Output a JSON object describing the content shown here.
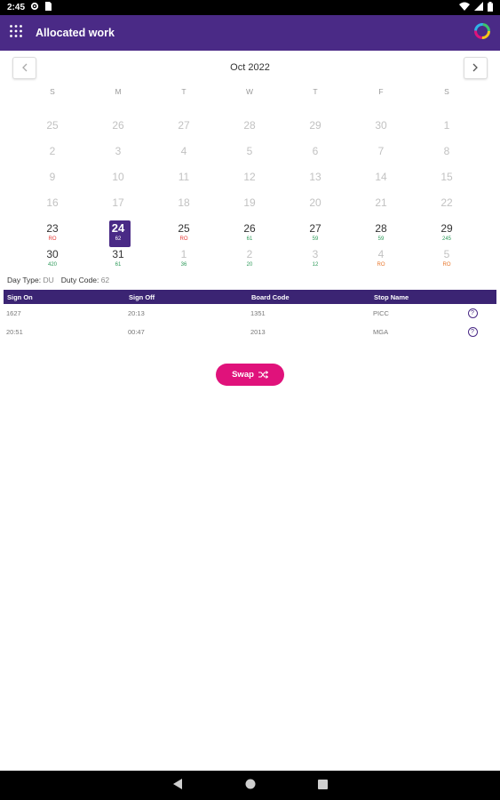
{
  "status_bar": {
    "time": "2:45"
  },
  "app_bar": {
    "title": "Allocated work"
  },
  "calendar": {
    "month_label": "Oct 2022",
    "weekdays": [
      "S",
      "M",
      "T",
      "W",
      "T",
      "F",
      "S"
    ],
    "weeks": [
      [
        {
          "d": "25",
          "muted": true,
          "code": ""
        },
        {
          "d": "26",
          "muted": true,
          "code": ""
        },
        {
          "d": "27",
          "muted": true,
          "code": ""
        },
        {
          "d": "28",
          "muted": true,
          "code": ""
        },
        {
          "d": "29",
          "muted": true,
          "code": ""
        },
        {
          "d": "30",
          "muted": true,
          "code": ""
        },
        {
          "d": "1",
          "muted": true,
          "code": ""
        }
      ],
      [
        {
          "d": "2",
          "muted": true,
          "code": ""
        },
        {
          "d": "3",
          "muted": true,
          "code": ""
        },
        {
          "d": "4",
          "muted": true,
          "code": ""
        },
        {
          "d": "5",
          "muted": true,
          "code": ""
        },
        {
          "d": "6",
          "muted": true,
          "code": ""
        },
        {
          "d": "7",
          "muted": true,
          "code": ""
        },
        {
          "d": "8",
          "muted": true,
          "code": ""
        }
      ],
      [
        {
          "d": "9",
          "muted": true,
          "code": ""
        },
        {
          "d": "10",
          "muted": true,
          "code": ""
        },
        {
          "d": "11",
          "muted": true,
          "code": ""
        },
        {
          "d": "12",
          "muted": true,
          "code": ""
        },
        {
          "d": "13",
          "muted": true,
          "code": ""
        },
        {
          "d": "14",
          "muted": true,
          "code": ""
        },
        {
          "d": "15",
          "muted": true,
          "code": ""
        }
      ],
      [
        {
          "d": "16",
          "muted": true,
          "code": ""
        },
        {
          "d": "17",
          "muted": true,
          "code": ""
        },
        {
          "d": "18",
          "muted": true,
          "code": ""
        },
        {
          "d": "19",
          "muted": true,
          "code": ""
        },
        {
          "d": "20",
          "muted": true,
          "code": ""
        },
        {
          "d": "21",
          "muted": true,
          "code": ""
        },
        {
          "d": "22",
          "muted": true,
          "code": ""
        }
      ],
      [
        {
          "d": "23",
          "muted": false,
          "code": "RO",
          "color": "#e53935"
        },
        {
          "d": "24",
          "muted": false,
          "code": "62",
          "color": "#ffffff",
          "selected": true
        },
        {
          "d": "25",
          "muted": false,
          "code": "RO",
          "color": "#e53935"
        },
        {
          "d": "26",
          "muted": false,
          "code": "61",
          "color": "#2e9a5a"
        },
        {
          "d": "27",
          "muted": false,
          "code": "59",
          "color": "#2e9a5a"
        },
        {
          "d": "28",
          "muted": false,
          "code": "59",
          "color": "#2e9a5a"
        },
        {
          "d": "29",
          "muted": false,
          "code": "245",
          "color": "#2e9a5a"
        }
      ],
      [
        {
          "d": "30",
          "muted": false,
          "code": "420",
          "color": "#2e9a5a"
        },
        {
          "d": "31",
          "muted": false,
          "code": "61",
          "color": "#2e9a5a"
        },
        {
          "d": "1",
          "muted": true,
          "code": "36",
          "color": "#2e9a5a"
        },
        {
          "d": "2",
          "muted": true,
          "code": "20",
          "color": "#2e9a5a"
        },
        {
          "d": "3",
          "muted": true,
          "code": "12",
          "color": "#2e9a5a"
        },
        {
          "d": "4",
          "muted": true,
          "code": "RO",
          "color": "#e8762b"
        },
        {
          "d": "5",
          "muted": true,
          "code": "RO",
          "color": "#e8762b"
        }
      ]
    ]
  },
  "duty": {
    "day_type_label": "Day Type:",
    "day_type_value": "DU",
    "duty_code_label": "Duty Code:",
    "duty_code_value": "62"
  },
  "table": {
    "headers": [
      "Sign On",
      "Sign Off",
      "Board Code",
      "Stop Name"
    ],
    "rows": [
      [
        "1627",
        "20:13",
        "1351",
        "PICC"
      ],
      [
        "20:51",
        "00:47",
        "2013",
        "MGA"
      ]
    ]
  },
  "swap_button": {
    "label": "Swap"
  },
  "colors": {
    "primary": "#4a2a86",
    "accent": "#e0127b",
    "green": "#2e9a5a",
    "red": "#e53935",
    "orange": "#e8762b"
  }
}
